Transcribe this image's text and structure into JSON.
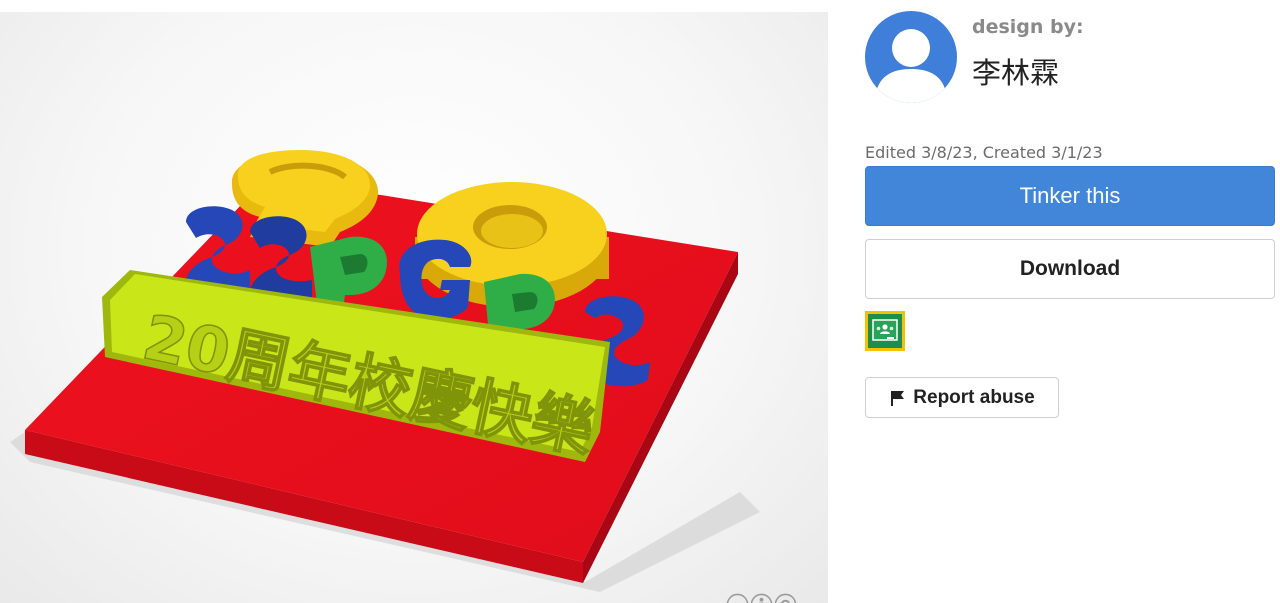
{
  "designer": {
    "label": "design by:",
    "name": "李林霖"
  },
  "meta": {
    "dates": "Edited 3/8/23, Created 3/1/23"
  },
  "actions": {
    "tinker_label": "Tinker this",
    "download_label": "Download",
    "report_label": "Report abuse"
  },
  "model": {
    "digits": "20",
    "letters": "SSPGPS",
    "caption": "20周年校慶快樂"
  },
  "icons": {
    "avatar": "default-user-avatar",
    "classroom": "google-classroom-icon",
    "report": "flag-icon",
    "license": [
      "creative-commons-icon",
      "attribution-icon",
      "share-alike-icon"
    ]
  },
  "colors": {
    "tinker_button": "#4286d9",
    "base_plate": "#e8101f",
    "digits": "#f7d11e",
    "letters_blue": "#2647b8",
    "letters_green": "#2fae48",
    "caption": "#c9e619",
    "classroom_border": "#f4c300",
    "classroom_bg": "#1e8e4e"
  }
}
